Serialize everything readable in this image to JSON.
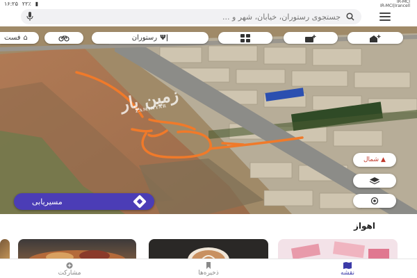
{
  "status": {
    "time": "۱۶:۲۵",
    "battery": "۲۲٪",
    "carrier_top": "IR-MCI",
    "carrier_bottom": "IR-MCI|Irancell"
  },
  "search": {
    "placeholder": "جستجوی رستوران، خیابان، شهر و ..."
  },
  "chips": {
    "restaurant_label": "رستوران",
    "restaurant_icon": "cutlery-icon",
    "partial_label": "فست"
  },
  "map": {
    "watermark": "زمین یار",
    "watermark_sub": "ZAMINYAR"
  },
  "fabs": {
    "north_label": "شمال"
  },
  "route_button": {
    "label": "مسیریابی"
  },
  "sheet": {
    "title": "اهواز"
  },
  "tabs": [
    {
      "label": "مشارکت",
      "icon": "plus-circle-icon"
    },
    {
      "label": "ذخیره‌ها",
      "icon": "bookmark-icon"
    },
    {
      "label": "نقشه",
      "icon": "map-icon"
    }
  ],
  "colors": {
    "accent": "#4b3db6",
    "route_orange": "#f07a2a"
  }
}
